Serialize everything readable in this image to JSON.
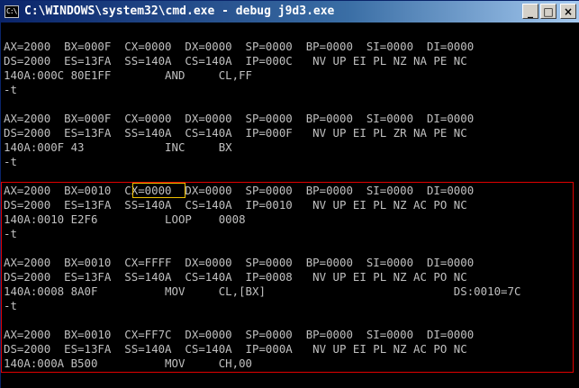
{
  "window": {
    "icon_text": "C:\\",
    "title": "C:\\WINDOWS\\system32\\cmd.exe - debug j9d3.exe",
    "buttons": {
      "minimize": "_",
      "maximize": "□",
      "close": "×"
    }
  },
  "console": {
    "lines": [
      "",
      "AX=2000  BX=000F  CX=0000  DX=0000  SP=0000  BP=0000  SI=0000  DI=0000",
      "DS=2000  ES=13FA  SS=140A  CS=140A  IP=000C   NV UP EI PL NZ NA PE NC",
      "140A:000C 80E1FF        AND     CL,FF",
      "-t",
      "",
      "AX=2000  BX=000F  CX=0000  DX=0000  SP=0000  BP=0000  SI=0000  DI=0000",
      "DS=2000  ES=13FA  SS=140A  CS=140A  IP=000F   NV UP EI PL ZR NA PE NC",
      "140A:000F 43            INC     BX",
      "-t",
      "",
      "AX=2000  BX=0010  CX=0000  DX=0000  SP=0000  BP=0000  SI=0000  DI=0000",
      "DS=2000  ES=13FA  SS=140A  CS=140A  IP=0010   NV UP EI PL NZ AC PO NC",
      "140A:0010 E2F6          LOOP    0008",
      "-t",
      "",
      "AX=2000  BX=0010  CX=FFFF  DX=0000  SP=0000  BP=0000  SI=0000  DI=0000",
      "DS=2000  ES=13FA  SS=140A  CS=140A  IP=0008   NV UP EI PL NZ AC PO NC",
      "140A:0008 8A0F          MOV     CL,[BX]                            DS:0010=7C",
      "-t",
      "",
      "AX=2000  BX=0010  CX=FF7C  DX=0000  SP=0000  BP=0000  SI=0000  DI=0000",
      "DS=2000  ES=13FA  SS=140A  CS=140A  IP=000A   NV UP EI PL NZ AC PO NC",
      "140A:000A B500          MOV     CH,00",
      ""
    ]
  },
  "annotations": {
    "selection_color": "#e00000",
    "highlight_color": "#f0c000"
  }
}
